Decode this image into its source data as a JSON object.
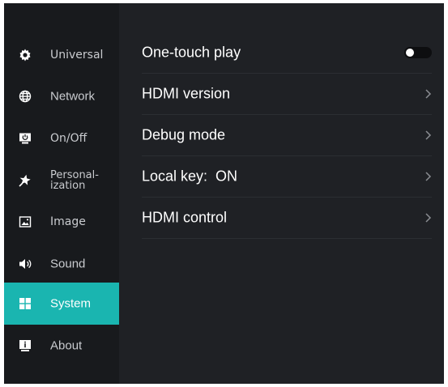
{
  "sidebar": {
    "items": [
      {
        "label": "Universal",
        "icon": "gear-icon"
      },
      {
        "label": "Network",
        "icon": "globe-icon"
      },
      {
        "label": "On/Off",
        "icon": "power-monitor-icon"
      },
      {
        "label_line1": "Personal-",
        "label_line2": "ization",
        "icon": "star-icon"
      },
      {
        "label": "Image",
        "icon": "image-icon"
      },
      {
        "label": "Sound",
        "icon": "speaker-icon"
      },
      {
        "label": "System",
        "icon": "system-grid-icon",
        "active": true
      },
      {
        "label": "About",
        "icon": "info-monitor-icon"
      }
    ]
  },
  "settings": {
    "rows": [
      {
        "label": "One-touch play",
        "control": "toggle",
        "toggle_on": false
      },
      {
        "label": "HDMI version",
        "control": "chevron"
      },
      {
        "label": "Debug mode",
        "control": "chevron"
      },
      {
        "label": "Local key:  ON",
        "control": "chevron"
      },
      {
        "label": "HDMI control",
        "control": "chevron"
      }
    ]
  },
  "colors": {
    "background": "#1f2125",
    "sidebar": "#181a1d",
    "accent": "#1ab5b0",
    "text": "#ffffff",
    "text_muted": "#c9cbcf"
  }
}
